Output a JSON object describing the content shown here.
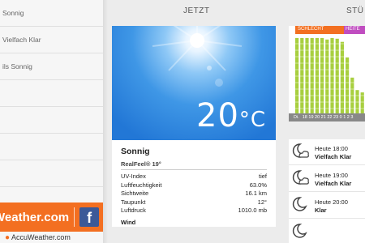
{
  "sidebar": {
    "items": [
      {
        "label": "Sonnig"
      },
      {
        "label": "Vielfach Klar"
      },
      {
        "label": "ils Sonnig"
      }
    ],
    "brand": "AccuWeather.com",
    "brand_visible": "Weather.com",
    "facebook": "f",
    "footer": "AccuWeather.com"
  },
  "now": {
    "title": "JETZT",
    "temp": "20",
    "unit": "°C",
    "condition": "Sonnig",
    "realfeel": "RealFeel® 19°",
    "stats": [
      {
        "label": "UV-Index",
        "value": "tief"
      },
      {
        "label": "Luftfeuchtigkeit",
        "value": "63.0%"
      },
      {
        "label": "Sichtweite",
        "value": "16.1 km"
      },
      {
        "label": "Taupunkt",
        "value": "12°"
      },
      {
        "label": "Luftdruck",
        "value": "1010.0 mb"
      }
    ],
    "wind_label": "Wind"
  },
  "hourly": {
    "title": "STÜ",
    "band_bad": "SCHLECHT",
    "band_good": "HEITE",
    "axis_label": "Di.",
    "axis_ticks": "18 19 20 21 22 23 0 1 2 3",
    "rows": [
      {
        "time": "Heute 18:00",
        "condition": "Vielfach Klar",
        "icon": "moon-cloud-icon"
      },
      {
        "time": "Heute 19:00",
        "condition": "Vielfach Klar",
        "icon": "moon-cloud-icon"
      },
      {
        "time": "Heute 20:00",
        "condition": "Klar",
        "icon": "moon-icon"
      }
    ],
    "bar_levels": [
      0.97,
      0.97,
      0.97,
      0.97,
      0.97,
      0.97,
      0.95,
      0.97,
      0.96,
      0.92,
      0.72,
      0.46,
      0.3,
      0.27
    ]
  },
  "colors": {
    "brand_orange": "#f36f21",
    "facebook_blue": "#3b5998",
    "chart_green": "#a8cf3f",
    "band_purple": "#c04dc0",
    "sky_blue": "#2f86dd"
  }
}
